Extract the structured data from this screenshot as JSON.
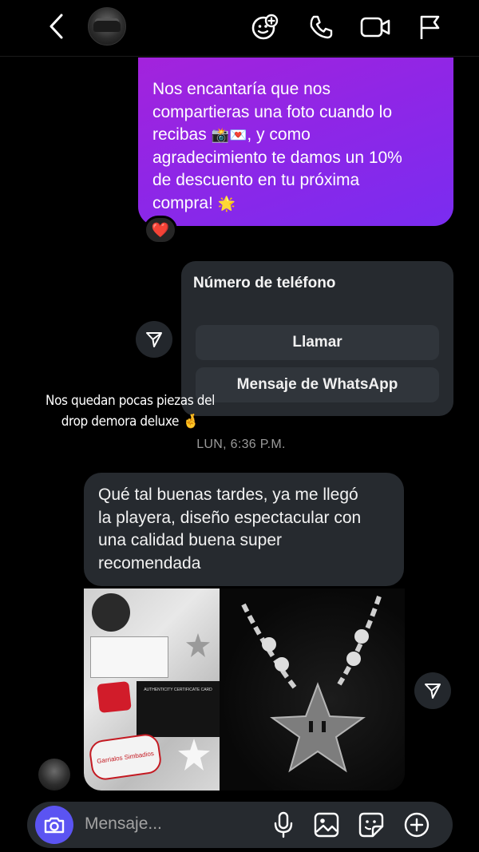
{
  "header": {
    "back_icon": "chevron-left-icon",
    "actions": [
      "avatar-effects-icon",
      "phone-icon",
      "video-icon",
      "flag-icon"
    ]
  },
  "messages": {
    "purple_lines": [
      "Nos encantaría que nos",
      "compartieras una foto cuando lo",
      "recibas",
      ", y como",
      "agradecimiento te damos un 10%",
      "de descuento en tu próxima",
      "compra!"
    ],
    "purple_emoji_1": "📸",
    "purple_emoji_2": "💌",
    "purple_emoji_3": "🌟",
    "reaction": "❤️",
    "card": {
      "title": "Número de teléfono",
      "call_label": "Llamar",
      "whatsapp_label": "Mensaje de WhatsApp"
    },
    "sticker_lines": [
      "Nos quedan pocas piezas del",
      "drop demora deluxe"
    ],
    "sticker_emoji": "🤞",
    "timestamp": "LUN, 6:36 P.M.",
    "gray_lines": [
      "Qué tal buenas tardes, ya me llegó",
      "la playera, diseño espectacular con",
      "una calidad buena super",
      "recomendada"
    ],
    "photo_text": {
      "card_title": "AUTHENTICITY CERTIFICATE CARD",
      "sticker_brand": "Garrialos Simbadios"
    }
  },
  "composer": {
    "placeholder": "Mensaje..."
  },
  "colors": {
    "accent": "#5b54f2",
    "bubble_purple": "#8f26e6",
    "bubble_gray": "#262a2f",
    "reaction_heart": "#ff2a3d"
  }
}
